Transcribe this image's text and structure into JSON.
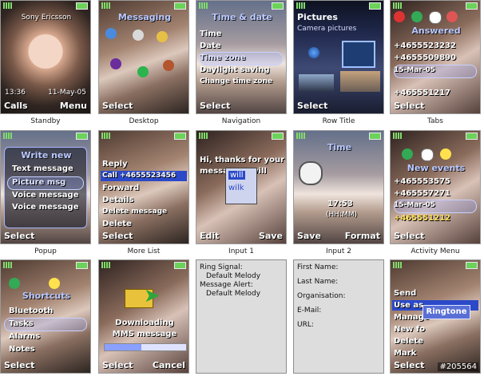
{
  "captions": [
    "Standby",
    "Desktop",
    "Navigation",
    "Row Title",
    "Tabs",
    "Popup",
    "More List",
    "Input 1",
    "Input 2",
    "Activity Menu"
  ],
  "standby": {
    "brand": "Sony Ericsson",
    "time": "13:36",
    "date": "11-May-05",
    "left": "Calls",
    "right": "Menu"
  },
  "desktop": {
    "title": "Messaging",
    "left": "Select"
  },
  "navigation": {
    "title": "Time & date",
    "items": [
      "Time",
      "Date",
      "Time zone",
      "Daylight saving",
      "Change time zone"
    ],
    "left": "Select"
  },
  "rowtitle": {
    "title": "Pictures",
    "subtitle": "Camera pictures",
    "left": "Select"
  },
  "tabs": {
    "title": "Answered",
    "rows": [
      "+4655523232",
      "+4655509890",
      "15-Mar-05",
      "+465551217"
    ],
    "left": "Select"
  },
  "popup": {
    "title": "Write new",
    "items": [
      "Text message",
      "Picture msg",
      "Voice message",
      "Voice message"
    ],
    "left": "Select"
  },
  "morelist": {
    "items": [
      "Reply",
      "Call +4655523456",
      "Forward",
      "Details",
      "Delete message",
      "Delete"
    ],
    "left": "Select"
  },
  "input1": {
    "text": "Hi, thanks for your message. I will",
    "words": [
      "will",
      "wilk"
    ],
    "left": "Edit",
    "right": "Save"
  },
  "input2": {
    "title": "Time",
    "value": "17:53",
    "hint": "(HH:MM)",
    "left": "Save",
    "right": "Format"
  },
  "activity": {
    "title": "New events",
    "rows": [
      "+465553575",
      "+465557271",
      "15-Mar-05",
      "+465551212"
    ],
    "left": "Select"
  },
  "shortcuts": {
    "title": "Shortcuts",
    "items": [
      "Bluetooth",
      "Tasks",
      "Alarms",
      "Notes"
    ],
    "left": "Select"
  },
  "download": {
    "text": "Downloading MMS message",
    "left": "Select",
    "right": "Cancel"
  },
  "ringinfo": {
    "lines": [
      "Ring Signal:",
      "Default Melody",
      "Message Alert:",
      "Default Melody"
    ]
  },
  "contactform": {
    "fields": [
      "First Name:",
      "Last Name:",
      "Organisation:",
      "E-Mail:",
      "URL:"
    ]
  },
  "sendmenu": {
    "items": [
      "Send",
      "Use as",
      "Manage",
      "New fo",
      "Delete",
      "Mark"
    ],
    "popup": "Ringtone",
    "left": "Select",
    "watermark": "#205564"
  }
}
